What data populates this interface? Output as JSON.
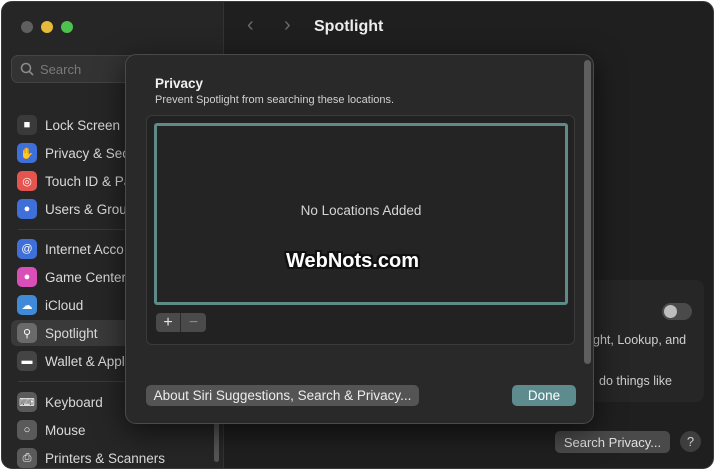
{
  "window": {
    "title": "Spotlight"
  },
  "search": {
    "placeholder": "Search"
  },
  "sidebar": {
    "items": [
      {
        "label": "Lock Screen",
        "icon": "lock-icon",
        "color": "#3a3a3a"
      },
      {
        "label": "Privacy & Sec",
        "icon": "hand-icon",
        "color": "#3f6fd8"
      },
      {
        "label": "Touch ID & Pa",
        "icon": "fingerprint-icon",
        "color": "#e5554f"
      },
      {
        "label": "Users & Grou",
        "icon": "users-icon",
        "color": "#3f6fd8"
      },
      {
        "label": "Internet Acco",
        "icon": "at-icon",
        "color": "#3f6fd8"
      },
      {
        "label": "Game Center",
        "icon": "game-center-icon",
        "color": "#d94fb7"
      },
      {
        "label": "iCloud",
        "icon": "cloud-icon",
        "color": "#3f8bd8"
      },
      {
        "label": "Spotlight",
        "icon": "magnifier-icon",
        "color": "#6a6a6a"
      },
      {
        "label": "Wallet & Appl",
        "icon": "wallet-icon",
        "color": "#444444"
      },
      {
        "label": "Keyboard",
        "icon": "keyboard-icon",
        "color": "#5a5a5a"
      },
      {
        "label": "Mouse",
        "icon": "mouse-icon",
        "color": "#5a5a5a"
      },
      {
        "label": "Printers & Scanners",
        "icon": "printer-icon",
        "color": "#5a5a5a"
      }
    ]
  },
  "background": {
    "line1": "ght, Lookup, and",
    "line2": "do things like",
    "search_privacy_label": "Search Privacy...",
    "help_label": "?"
  },
  "sheet": {
    "title": "Privacy",
    "subtitle": "Prevent Spotlight from searching these locations.",
    "empty_text": "No Locations Added",
    "plus_label": "+",
    "minus_label": "−",
    "watermark": "WebNots.com",
    "about_label": "About Siri Suggestions, Search & Privacy...",
    "done_label": "Done"
  },
  "colors": {
    "accent": "#5d8b8e",
    "list_border": "#5e8a88"
  }
}
